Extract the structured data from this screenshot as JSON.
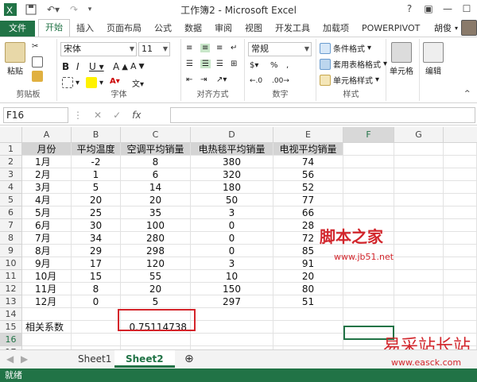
{
  "window": {
    "title": "工作簿2 - Microsoft Excel",
    "user": "胡俊"
  },
  "tabs": [
    "文件",
    "开始",
    "插入",
    "页面布局",
    "公式",
    "数据",
    "审阅",
    "视图",
    "开发工具",
    "加载项",
    "POWERPIVOT"
  ],
  "ribbon": {
    "paste": "粘贴",
    "clipboard": "剪贴板",
    "font_name": "宋体",
    "font_size": "11",
    "font_group": "字体",
    "align_group": "对齐方式",
    "number_format": "常规",
    "number_group": "数字",
    "cond_format": "条件格式",
    "table_format": "套用表格格式",
    "cell_style": "单元格样式",
    "style_group": "样式",
    "cells": "单元格",
    "edit": "编辑"
  },
  "formula_bar": {
    "name_box": "F16",
    "fx": "fx",
    "formula": ""
  },
  "columns": [
    "A",
    "B",
    "C",
    "D",
    "E",
    "F",
    "G"
  ],
  "rows": [
    "1",
    "2",
    "3",
    "4",
    "5",
    "6",
    "7",
    "8",
    "9",
    "10",
    "11",
    "12",
    "13",
    "14",
    "15",
    "16",
    "17"
  ],
  "table": {
    "headers": [
      "月份",
      "平均温度",
      "空调平均销量",
      "电热毯平均销量",
      "电视平均销量"
    ],
    "data": [
      [
        "1月",
        "-2",
        "8",
        "380",
        "74"
      ],
      [
        "2月",
        "1",
        "6",
        "320",
        "56"
      ],
      [
        "3月",
        "5",
        "14",
        "180",
        "52"
      ],
      [
        "4月",
        "20",
        "20",
        "50",
        "77"
      ],
      [
        "5月",
        "25",
        "35",
        "3",
        "66"
      ],
      [
        "6月",
        "30",
        "100",
        "0",
        "28"
      ],
      [
        "7月",
        "34",
        "280",
        "0",
        "72"
      ],
      [
        "8月",
        "29",
        "298",
        "0",
        "85"
      ],
      [
        "9月",
        "17",
        "120",
        "3",
        "91"
      ],
      [
        "10月",
        "15",
        "55",
        "10",
        "20"
      ],
      [
        "11月",
        "8",
        "20",
        "150",
        "80"
      ],
      [
        "12月",
        "0",
        "5",
        "297",
        "51"
      ]
    ],
    "corr_label": "相关系数",
    "corr_value": "0.75114738"
  },
  "sheets": [
    "Sheet1",
    "Sheet2"
  ],
  "status": "就绪",
  "watermarks": {
    "jb51": "脚本之家",
    "jb51_url": "www.jb51.net",
    "easck": "易采站长站",
    "easck_url": "www.easck.com"
  },
  "colors": {
    "excel_green": "#217346",
    "highlight_red": "#d4242a"
  }
}
